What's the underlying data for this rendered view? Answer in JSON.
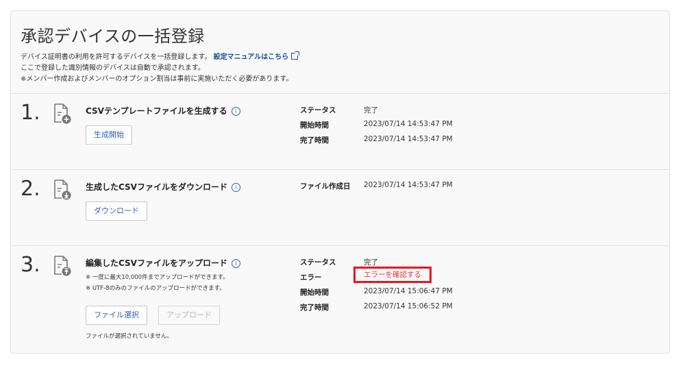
{
  "title": "承認デバイスの一括登録",
  "description": {
    "line1": "デバイス証明書の利用を許可するデバイスを一括登録します。",
    "line1_link": "設定マニュアルはこちら",
    "line2": "ここで登録した識別情報のデバイスは自動で承認されます。",
    "line3": "※メンバー作成およびメンバーのオプション割当は事前に実施いただく必要があります。"
  },
  "info_icon_glyph": "i",
  "steps": [
    {
      "number": "1.",
      "icon": "file-plus-icon",
      "title": "CSVテンプレートファイルを生成する",
      "button": "生成開始",
      "labels": [
        "ステータス",
        "開始時間",
        "完了時間"
      ],
      "values": [
        "完了",
        "2023/07/14 14:53:47 PM",
        "2023/07/14 14:53:47 PM"
      ]
    },
    {
      "number": "2.",
      "icon": "file-download-icon",
      "title": "生成したCSVファイルをダウンロード",
      "button": "ダウンロード",
      "labels": [
        "ファイル作成日"
      ],
      "values": [
        "2023/07/14 14:53:47 PM"
      ]
    },
    {
      "number": "3.",
      "icon": "file-upload-icon",
      "title": "編集したCSVファイルをアップロード",
      "notes": [
        "※ 一度に最大10,000件までアップロードができます。",
        "※ UTF-8のみのファイルのアップロードができます。"
      ],
      "select_button": "ファイル選択",
      "upload_button": "アップロード",
      "file_status": "ファイルが選択されていません。",
      "labels": [
        "ステータス",
        "エラー",
        "開始時間",
        "完了時間"
      ],
      "values": [
        "完了",
        "エラーを確認する",
        "2023/07/14 15:06:47 PM",
        "2023/07/14 15:06:52 PM"
      ]
    }
  ],
  "colors": {
    "link": "#1a4aa3",
    "error": "#e23a3a",
    "highlight_border": "#e8141c"
  }
}
